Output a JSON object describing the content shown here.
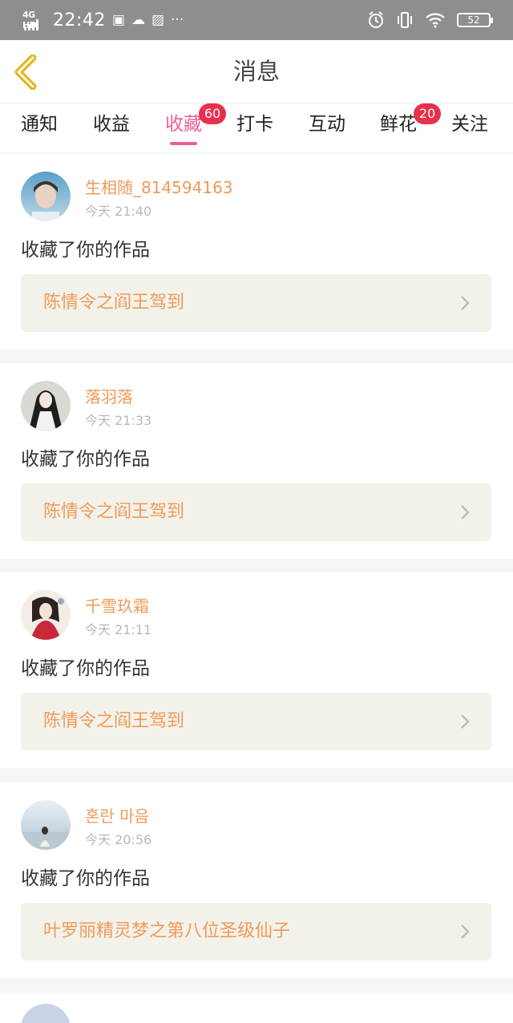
{
  "status_bar": {
    "network": "4G HD",
    "time": "22:42",
    "notif_icons": [
      "sim-icon",
      "cloud-icon",
      "app-icon"
    ],
    "more": "···",
    "battery": "52"
  },
  "header": {
    "title": "消息"
  },
  "tabs": [
    {
      "label": "通知",
      "badge": ""
    },
    {
      "label": "收益",
      "badge": ""
    },
    {
      "label": "收藏",
      "badge": "60",
      "active": true
    },
    {
      "label": "打卡",
      "badge": ""
    },
    {
      "label": "互动",
      "badge": ""
    },
    {
      "label": "鲜花",
      "badge": "20"
    },
    {
      "label": "关注",
      "badge": ""
    }
  ],
  "messages": [
    {
      "user": "生相随_814594163",
      "time": "今天 21:40",
      "action": "收藏了你的作品",
      "work": "陈情令之阎王驾到"
    },
    {
      "user": "落羽落",
      "time": "今天 21:33",
      "action": "收藏了你的作品",
      "work": "陈情令之阎王驾到"
    },
    {
      "user": "千雪玖霜",
      "time": "今天 21:11",
      "action": "收藏了你的作品",
      "work": "陈情令之阎王驾到"
    },
    {
      "user": "혼란 마음",
      "time": "今天 20:56",
      "action": "收藏了你的作品",
      "work": "叶罗丽精灵梦之第八位圣级仙子"
    }
  ],
  "colors": {
    "accent": "#e8609a",
    "name": "#ef9a58",
    "badge": "#e8304a",
    "work_bg": "#f3f2ea",
    "back_arrow": "#e0b52c"
  }
}
